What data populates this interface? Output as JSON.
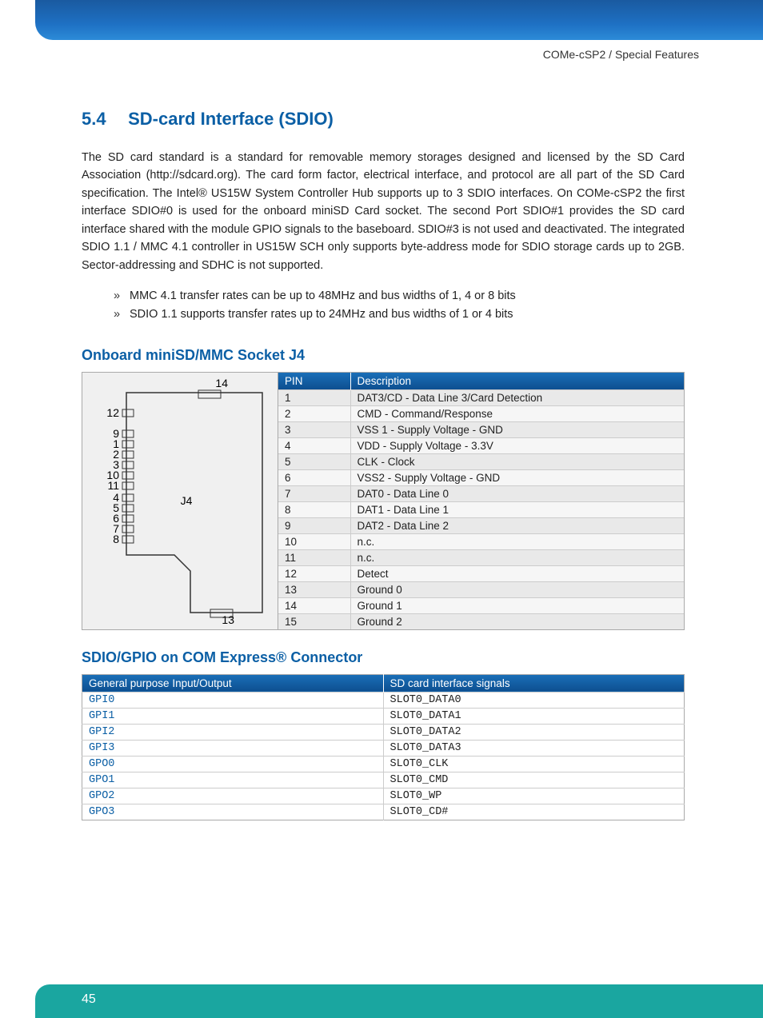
{
  "header": {
    "breadcrumb": "COMe-cSP2 / Special Features"
  },
  "section": {
    "number": "5.4",
    "title": "SD-card Interface (SDIO)",
    "paragraph": "The SD card standard is a standard for removable memory storages designed and licensed by the SD Card Association (http://sdcard.org). The card form factor, electrical interface, and protocol are all part of the SD Card specification. The Intel® US15W System Controller Hub supports up to 3 SDIO interfaces. On COMe-cSP2 the first interface SDIO#0 is used for the onboard miniSD Card socket. The second Port SDIO#1 provides the SD card interface shared with the module GPIO signals to the baseboard. SDIO#3 is not used and deactivated. The integrated SDIO 1.1 / MMC 4.1 controller in US15W SCH only supports byte-address mode for SDIO storage cards up to 2GB. Sector-addressing and SDHC is not supported.",
    "bullets": [
      "MMC 4.1 transfer rates can be up to 48MHz and bus widths of 1, 4 or 8 bits",
      "SDIO 1.1 supports transfer rates up to 24MHz and bus widths of 1 or 4 bits"
    ]
  },
  "table1": {
    "heading": "Onboard miniSD/MMC Socket J4",
    "headers": {
      "pin": "PIN",
      "desc": "Description"
    },
    "diagram_label": "J4",
    "diagram_pins_top": "14",
    "diagram_pins_bottom": "13",
    "diagram_left_labels": [
      "12",
      "9",
      "1",
      "2",
      "3",
      "10",
      "11",
      "4",
      "5",
      "6",
      "7",
      "8"
    ],
    "rows": [
      {
        "pin": "1",
        "desc": "DAT3/CD - Data Line 3/Card Detection"
      },
      {
        "pin": "2",
        "desc": "CMD - Command/Response"
      },
      {
        "pin": "3",
        "desc": "VSS 1 - Supply Voltage - GND"
      },
      {
        "pin": "4",
        "desc": "VDD - Supply Voltage - 3.3V"
      },
      {
        "pin": "5",
        "desc": "CLK - Clock"
      },
      {
        "pin": "6",
        "desc": "VSS2 - Supply Voltage - GND"
      },
      {
        "pin": "7",
        "desc": "DAT0 - Data Line 0"
      },
      {
        "pin": "8",
        "desc": "DAT1 - Data Line 1"
      },
      {
        "pin": "9",
        "desc": "DAT2 - Data Line 2"
      },
      {
        "pin": "10",
        "desc": "n.c."
      },
      {
        "pin": "11",
        "desc": "n.c."
      },
      {
        "pin": "12",
        "desc": "Detect"
      },
      {
        "pin": "13",
        "desc": "Ground 0"
      },
      {
        "pin": "14",
        "desc": "Ground 1"
      },
      {
        "pin": "15",
        "desc": "Ground 2"
      }
    ]
  },
  "table2": {
    "heading": "SDIO/GPIO on COM Express® Connector",
    "headers": {
      "gpio": "General purpose Input/Output",
      "sig": "SD card  interface signals"
    },
    "rows": [
      {
        "gpio": "GPI0",
        "sig": "SLOT0_DATA0"
      },
      {
        "gpio": "GPI1",
        "sig": "SLOT0_DATA1"
      },
      {
        "gpio": "GPI2",
        "sig": "SLOT0_DATA2"
      },
      {
        "gpio": "GPI3",
        "sig": "SLOT0_DATA3"
      },
      {
        "gpio": "GPO0",
        "sig": "SLOT0_CLK"
      },
      {
        "gpio": "GPO1",
        "sig": "SLOT0_CMD"
      },
      {
        "gpio": "GPO2",
        "sig": "SLOT0_WP"
      },
      {
        "gpio": "GPO3",
        "sig": "SLOT0_CD#"
      }
    ]
  },
  "footer": {
    "page": "45"
  }
}
